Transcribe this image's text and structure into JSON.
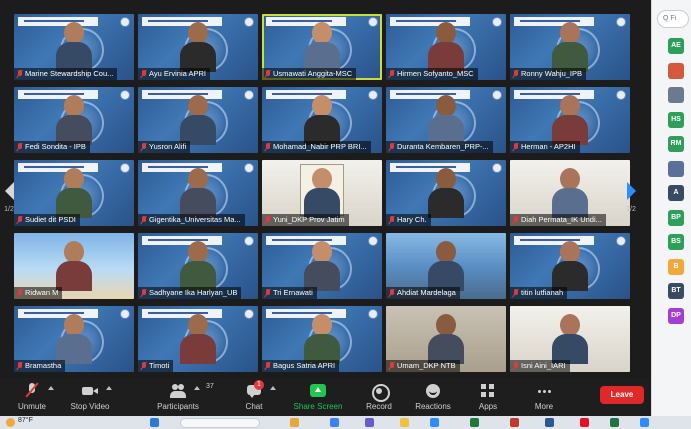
{
  "participants": [
    {
      "name": "Marine Stewardship Cou...",
      "bg": "blue",
      "active": false
    },
    {
      "name": "Ayu Ervinia APRI",
      "bg": "blue",
      "active": false
    },
    {
      "name": "Usmawati Anggita-MSC",
      "bg": "blue",
      "active": true
    },
    {
      "name": "Hirmen Sofyanto_MSC",
      "bg": "blue",
      "active": false
    },
    {
      "name": "Ronny Wahju_IPB",
      "bg": "blue",
      "active": false
    },
    {
      "name": "Fedi Sondita - IPB",
      "bg": "blue",
      "active": false
    },
    {
      "name": "Yusron Alifi",
      "bg": "blue",
      "active": false
    },
    {
      "name": "Mohamad_Nabir PRP BRI...",
      "bg": "blue",
      "active": false
    },
    {
      "name": "Duranta Kembaren_PRP-...",
      "bg": "blue",
      "active": false
    },
    {
      "name": "Herman - AP2HI",
      "bg": "blue",
      "active": false
    },
    {
      "name": "Sudiet dit PSDI",
      "bg": "blue",
      "active": false
    },
    {
      "name": "Gigentika_Universitas Ma...",
      "bg": "blue",
      "active": false
    },
    {
      "name": "Yuni_DKP Prov Jatim",
      "bg": "white",
      "active": false
    },
    {
      "name": "Hary Ch.",
      "bg": "blue",
      "active": false
    },
    {
      "name": "Diah Permata_IK Undi...",
      "bg": "white",
      "active": false
    },
    {
      "name": "Ridwan M",
      "bg": "sky",
      "active": false
    },
    {
      "name": "Sadhyane Ika Harlyan_UB",
      "bg": "blue",
      "active": false
    },
    {
      "name": "Tri Ernawati",
      "bg": "blue",
      "active": false
    },
    {
      "name": "Ahdiat Mardelaga",
      "bg": "window",
      "active": false
    },
    {
      "name": "titin lutfianah",
      "bg": "blue",
      "active": false
    },
    {
      "name": "Bramastha",
      "bg": "blue",
      "active": false
    },
    {
      "name": "Timoti",
      "bg": "blue",
      "active": false
    },
    {
      "name": "Bagus Satria APRI",
      "bg": "blue",
      "active": false
    },
    {
      "name": "Umam_DKP NTB",
      "bg": "room",
      "active": false
    },
    {
      "name": "Isni Aini_IARI",
      "bg": "white",
      "active": false
    }
  ],
  "pagination": {
    "left": "1/2",
    "right": "1/2"
  },
  "controls": {
    "unmute": "Unmute",
    "stop_video": "Stop Video",
    "participants": "Participants",
    "participant_count": "37",
    "chat": "Chat",
    "chat_badge": "1",
    "share_screen": "Share Screen",
    "record": "Record",
    "reactions": "Reactions",
    "apps": "Apps",
    "more": "More",
    "leave": "Leave"
  },
  "taskbar": {
    "weather": "87°F"
  },
  "sidebar": {
    "search_placeholder": "Q Fi",
    "avatars": [
      {
        "initials": "AE",
        "color": "#2f9e5b"
      },
      {
        "initials": "",
        "color": "#d35a3c"
      },
      {
        "initials": "",
        "color": "#6b7a8f"
      },
      {
        "initials": "HS",
        "color": "#2f9e5b"
      },
      {
        "initials": "RM",
        "color": "#2f9e5b"
      },
      {
        "initials": "",
        "color": "#5a6f9a"
      },
      {
        "initials": "A",
        "color": "#3a4a63"
      },
      {
        "initials": "BP",
        "color": "#2f9e5b"
      },
      {
        "initials": "BS",
        "color": "#2f9e5b"
      },
      {
        "initials": "B",
        "color": "#f2a93b"
      },
      {
        "initials": "BT",
        "color": "#3a4a63"
      },
      {
        "initials": "DP",
        "color": "#a23fd1"
      }
    ]
  }
}
